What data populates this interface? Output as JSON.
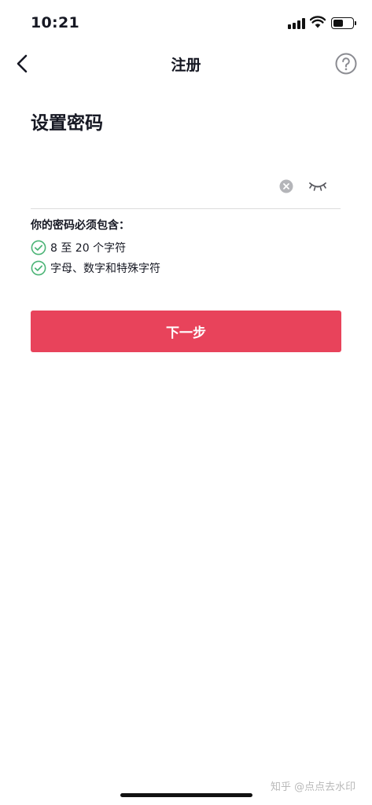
{
  "status_bar": {
    "time": "10:21",
    "battery_level": 0.55,
    "icons": [
      "signal-icon",
      "wifi-icon",
      "battery-icon"
    ]
  },
  "nav": {
    "title": "注册",
    "back_icon": "chevron-left-icon",
    "help_icon": "question-circle-icon"
  },
  "heading": "设置密码",
  "password_field": {
    "value": "",
    "placeholder": "",
    "clear_icon": "clear-circle-icon",
    "visibility_icon": "eye-closed-icon"
  },
  "requirements": {
    "title": "你的密码必须包含：",
    "items": [
      {
        "label": "8 至 20 个字符",
        "met": true
      },
      {
        "label": "字母、数字和特殊字符",
        "met": true
      }
    ]
  },
  "next_button": {
    "label": "下一步"
  },
  "watermark": "知乎 @点点去水印",
  "colors": {
    "primary": "#e8435b",
    "check": "#4bb476",
    "text": "#161823",
    "divider": "#dcdcdc"
  }
}
